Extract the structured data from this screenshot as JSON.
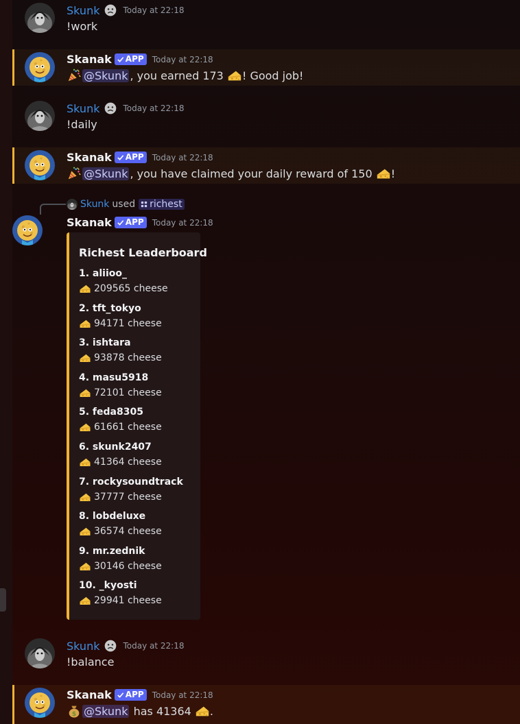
{
  "messages": {
    "m1": {
      "author": "Skunk",
      "timestamp": "Today at 22:18",
      "text": "!work"
    },
    "m2": {
      "author": "Skanak",
      "badge": "APP",
      "timestamp": "Today at 22:18",
      "mention": "@Skunk",
      "before": "",
      "after1": ", you earned 173 ",
      "after2": "! Good job!"
    },
    "m3": {
      "author": "Skunk",
      "timestamp": "Today at 22:18",
      "text": "!daily"
    },
    "m4": {
      "author": "Skanak",
      "badge": "APP",
      "timestamp": "Today at 22:18",
      "mention": "@Skunk",
      "after1": ", you have claimed your daily reward of 150 ",
      "after2": "!"
    },
    "m5": {
      "reply_author": "Skunk",
      "reply_used": "used",
      "reply_command": "richest",
      "author": "Skanak",
      "badge": "APP",
      "timestamp": "Today at 22:18",
      "embed": {
        "title": "Richest Leaderboard",
        "entries": [
          {
            "name": "1. aliioo_",
            "value": "209565 cheese"
          },
          {
            "name": "2. tft_tokyo",
            "value": "94171 cheese"
          },
          {
            "name": "3. ishtara",
            "value": "93878 cheese"
          },
          {
            "name": "4. masu5918",
            "value": "72101 cheese"
          },
          {
            "name": "5. feda8305",
            "value": "61661 cheese"
          },
          {
            "name": "6. skunk2407",
            "value": "41364 cheese"
          },
          {
            "name": "7. rockysoundtrack",
            "value": "37777 cheese"
          },
          {
            "name": "8. lobdeluxe",
            "value": "36574 cheese"
          },
          {
            "name": "9. mr.zednik",
            "value": "30146 cheese"
          },
          {
            "name": "10. _kyosti",
            "value": "29941 cheese"
          }
        ]
      }
    },
    "m6": {
      "author": "Skunk",
      "timestamp": "Today at 22:18",
      "text": "!balance"
    },
    "m7": {
      "author": "Skanak",
      "badge": "APP",
      "timestamp": "Today at 22:18",
      "mention": "@Skunk",
      "after1": " has 41364 ",
      "after2": "."
    }
  },
  "icons": {
    "status": "frowning-face-icon",
    "celebrate": "party-popper-icon",
    "currency": "cheese-wedge-icon",
    "money": "money-bag-icon",
    "verified": "checkmark-icon",
    "command": "slash-command-icon"
  },
  "colors": {
    "skunk_name": "#3e8ee0",
    "mention_highlight": "#f0b232",
    "app_badge": "#5865f2",
    "embed_accent": "#f0b232"
  }
}
